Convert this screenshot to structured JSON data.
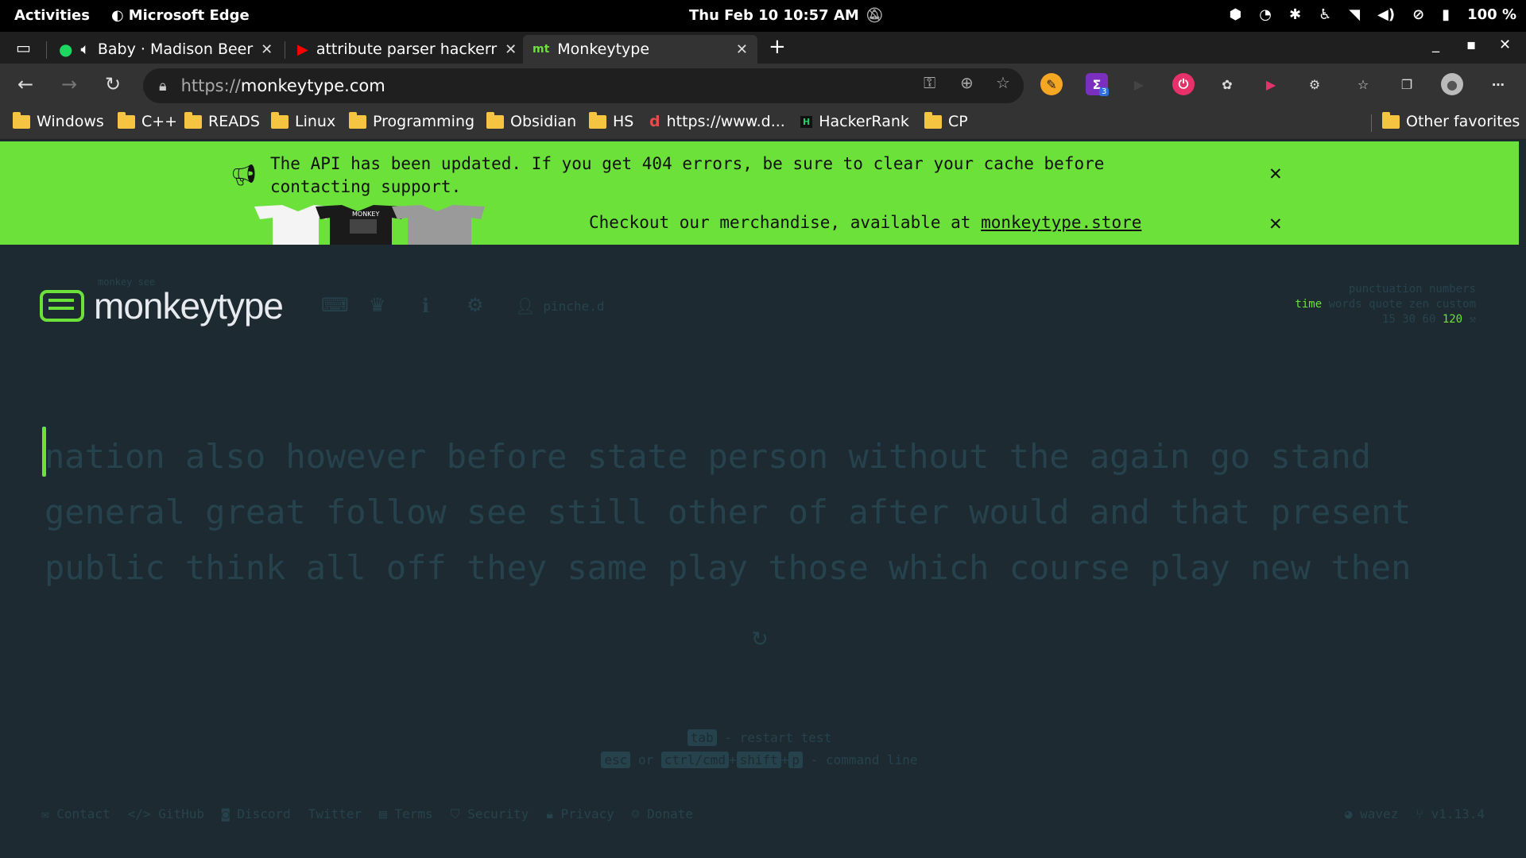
{
  "system": {
    "activities": "Activities",
    "app_name": "Microsoft Edge",
    "clock": "Thu Feb 10  10:57 AM",
    "battery": "100 %"
  },
  "browser": {
    "tabs": [
      {
        "label": "Baby · Madison Beer",
        "icon": "spotify-icon"
      },
      {
        "label": "attribute parser hackerr",
        "icon": "youtube-icon"
      },
      {
        "label": "Monkeytype",
        "icon": "monkeytype-icon"
      }
    ],
    "url_protocol": "https://",
    "url_host": "monkeytype.com",
    "bookmarks": [
      "Windows",
      "C++",
      "READS",
      "Linux",
      "Programming",
      "Obsidian",
      "HS",
      "https://www.d...",
      "HackerRank",
      "CP"
    ],
    "other_favorites": "Other favorites",
    "extension_badge": "3"
  },
  "banner": {
    "message": "The API has been updated. If you get 404 errors, be sure to clear your cache before contacting support.",
    "merch_text": "Checkout our merchandise, available at ",
    "merch_link": "monkeytype.store",
    "shirt_label": "MONKEY"
  },
  "site": {
    "logo": "monkeytype",
    "tagline": "monkey see",
    "username": "pinche.d"
  },
  "config": {
    "row1": "punctuation numbers",
    "mode_active": "time",
    "modes_rest": "words quote zen custom",
    "durations": "15 30 60",
    "duration_active": "120"
  },
  "test": {
    "lines": [
      "nation also however before state person without the again go stand",
      "general great follow see still other of after would and that present",
      "public think all off they same play those which course play new then"
    ]
  },
  "hints": {
    "tab_key": "tab",
    "restart": " - restart test",
    "esc_key": "esc",
    "or": " or ",
    "ctrl_key": "ctrl/cmd",
    "plus": "+",
    "shift_key": "shift",
    "p_key": "p",
    "command": " - command line"
  },
  "footer": {
    "links": [
      "Contact",
      "GitHub",
      "Discord",
      "Twitter",
      "Terms",
      "Security",
      "Privacy",
      "Donate"
    ],
    "theme": "wavez",
    "version": "v1.13.4"
  }
}
